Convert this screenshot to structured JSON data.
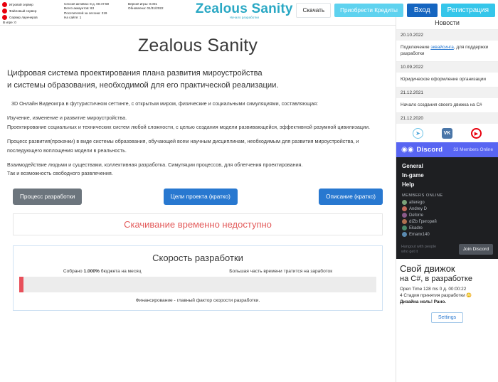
{
  "topbar": {
    "servers": [
      {
        "label": "Игровой сервер",
        "status_color": "#e8000d"
      },
      {
        "label": "Файловый сервер",
        "status_color": "#e8000d"
      },
      {
        "label": "Сервер лаунчеров",
        "status_color": "#e8000d"
      }
    ],
    "in_game": "В игре: 0",
    "stats": [
      "Сессия активна: 8 д. 00:47:59",
      "Всего аккаунтов: 63",
      "Посетителей за сессию: 219",
      "На сайте: 1"
    ],
    "version": [
      "Версия игры: 0.001",
      "Обновлена: 01/31/2022"
    ],
    "brand_title": "Zealous Sanity",
    "brand_sub": "Начало разработки",
    "nav": {
      "download": "Скачать",
      "credits": "Приобрести Кредиты",
      "login": "Вход",
      "register": "Регистрация"
    }
  },
  "main": {
    "hero_title": "Zealous Sanity",
    "lead_line1": "Цифровая система проектирования плана развития мироустройства",
    "lead_line2": "и системы образования, необходимой для его практической реализации.",
    "p1": "3D Онлайн Видеоигра в футуристичном сеттинге, с открытым миром, физические и социальными симуляциями, составляющая:",
    "p2_line1": "Изучение, изменение и развитие мироустройства.",
    "p2_line2": "Проектирование социальных и технических систем любой сложности, с целью создания модели развивающейся, эффективной разумной цивилизации.",
    "p3": "Процесс развития(прокачки) в виде системы образования, обучающей всем научным дисциплинам, необходимым для развития мироустройства, и последующего воплощения модели в реальность.",
    "p4_line1": "Взаимодействие людьми и существами, коллективная разработка. Симуляции процессов, для облегчения проектирования.",
    "p4_line2": "Так и возможность свободного развлечения.",
    "buttons": {
      "process": "Процесс разработки",
      "goals": "Цели проекта (кратко)",
      "description": "Описание (кратко)"
    },
    "notice": "Скачивание временно недоступно",
    "speed": {
      "title": "Скорость разработки",
      "left_label_prefix": "Собрано ",
      "left_label_value": "1.000%",
      "left_label_suffix": " бюджета на месяц",
      "right_label": "Большая часть времени тратится на заработок",
      "progress_percent": 1.0,
      "progress_color": "#e8505b",
      "footer": "Финансирование - главный фактор скорости разработки."
    }
  },
  "sidebar": {
    "news_title": "Новости",
    "news": [
      {
        "date": "20.10.2022",
        "text_before": "Подключение ",
        "link": "эквайсинга",
        "text_after": ", для поддержки разработки"
      },
      {
        "date": "10.09.2022",
        "text_before": "Юридическое оформление организации",
        "link": "",
        "text_after": ""
      },
      {
        "date": "21.12.2021",
        "text_before": "Начало создания своего движка на C#",
        "link": "",
        "text_after": ""
      },
      {
        "date": "21.12.2020",
        "text_before": "",
        "link": "",
        "text_after": ""
      }
    ],
    "social": [
      {
        "name": "telegram",
        "glyph": "➤"
      },
      {
        "name": "vk",
        "glyph": "VK"
      },
      {
        "name": "youtube",
        "glyph": "▶"
      }
    ],
    "discord": {
      "logo_glyph": "◉◉",
      "name": "Discord",
      "members_online": "33 Members Online",
      "channels": [
        "General",
        "In-game",
        "Help"
      ],
      "members_title": "MEMBERS ONLINE",
      "members": [
        {
          "name": "alterego",
          "color": "#7aa37a"
        },
        {
          "name": "Andrey D",
          "color": "#c46a5a"
        },
        {
          "name": "Deforre",
          "color": "#8a5a8a"
        },
        {
          "name": "dIZb Григорий",
          "color": "#b07050"
        },
        {
          "name": "Ekadre",
          "color": "#4a8a6a"
        },
        {
          "name": "Emanx140",
          "color": "#5a8ab0"
        }
      ],
      "tagline_line1": "Hangout with people",
      "tagline_line2": "who get it",
      "join_label": "Join Discord"
    },
    "engine": {
      "title_line1": "Свой движок",
      "title_line2": "на C#, в разработке",
      "open_time": "Open Time 128 ms 0 д. 00:00:22",
      "stage": "4 Стадия принятия разработки 😳",
      "design_note": "Дизайна ноль! Рано.",
      "settings_label": "Settings"
    }
  }
}
